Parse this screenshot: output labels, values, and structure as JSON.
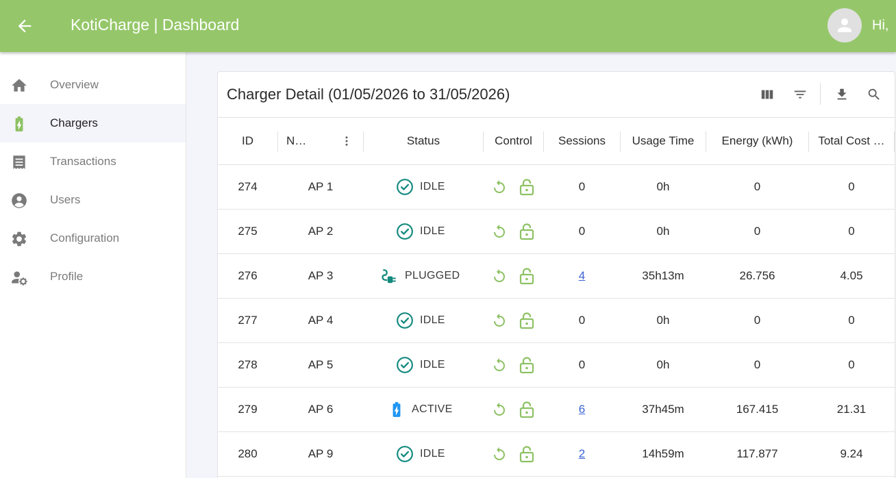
{
  "appbar": {
    "title": "KotiCharge | Dashboard",
    "greeting": "Hi,",
    "color": "#95c76a"
  },
  "sidebar": {
    "items": [
      {
        "label": "Overview",
        "icon": "home-icon",
        "selected": false
      },
      {
        "label": "Chargers",
        "icon": "battery-charging-icon",
        "selected": true
      },
      {
        "label": "Transactions",
        "icon": "receipt-icon",
        "selected": false
      },
      {
        "label": "Users",
        "icon": "account-circle-icon",
        "selected": false
      },
      {
        "label": "Configuration",
        "icon": "gear-icon",
        "selected": false
      },
      {
        "label": "Profile",
        "icon": "user-settings-icon",
        "selected": false
      }
    ]
  },
  "card": {
    "title": "Charger Detail (01/05/2026 to 31/05/2026)",
    "tools": [
      "view-columns-icon",
      "filter-icon",
      "download-icon",
      "search-icon"
    ]
  },
  "table": {
    "columns": [
      "ID",
      "N…",
      "Status",
      "Control",
      "Sessions",
      "Usage Time",
      "Energy (kWh)",
      "Total Cost …"
    ],
    "rows": [
      {
        "id": "274",
        "name": "AP 1",
        "status": "IDLE",
        "sessions": "0",
        "sessions_link": false,
        "usage": "0h",
        "energy": "0",
        "cost": "0"
      },
      {
        "id": "275",
        "name": "AP 2",
        "status": "IDLE",
        "sessions": "0",
        "sessions_link": false,
        "usage": "0h",
        "energy": "0",
        "cost": "0"
      },
      {
        "id": "276",
        "name": "AP 3",
        "status": "PLUGGED",
        "sessions": "4",
        "sessions_link": true,
        "usage": "35h13m",
        "energy": "26.756",
        "cost": "4.05"
      },
      {
        "id": "277",
        "name": "AP 4",
        "status": "IDLE",
        "sessions": "0",
        "sessions_link": false,
        "usage": "0h",
        "energy": "0",
        "cost": "0"
      },
      {
        "id": "278",
        "name": "AP 5",
        "status": "IDLE",
        "sessions": "0",
        "sessions_link": false,
        "usage": "0h",
        "energy": "0",
        "cost": "0"
      },
      {
        "id": "279",
        "name": "AP 6",
        "status": "ACTIVE",
        "sessions": "6",
        "sessions_link": true,
        "usage": "37h45m",
        "energy": "167.415",
        "cost": "21.31"
      },
      {
        "id": "280",
        "name": "AP 9",
        "status": "IDLE",
        "sessions": "2",
        "sessions_link": true,
        "usage": "14h59m",
        "energy": "117.877",
        "cost": "9.24"
      }
    ]
  },
  "colors": {
    "accent_green": "#8dc163",
    "status_teal": "#138a7e",
    "link_blue": "#3a62d4",
    "active_blue": "#2196f3"
  }
}
